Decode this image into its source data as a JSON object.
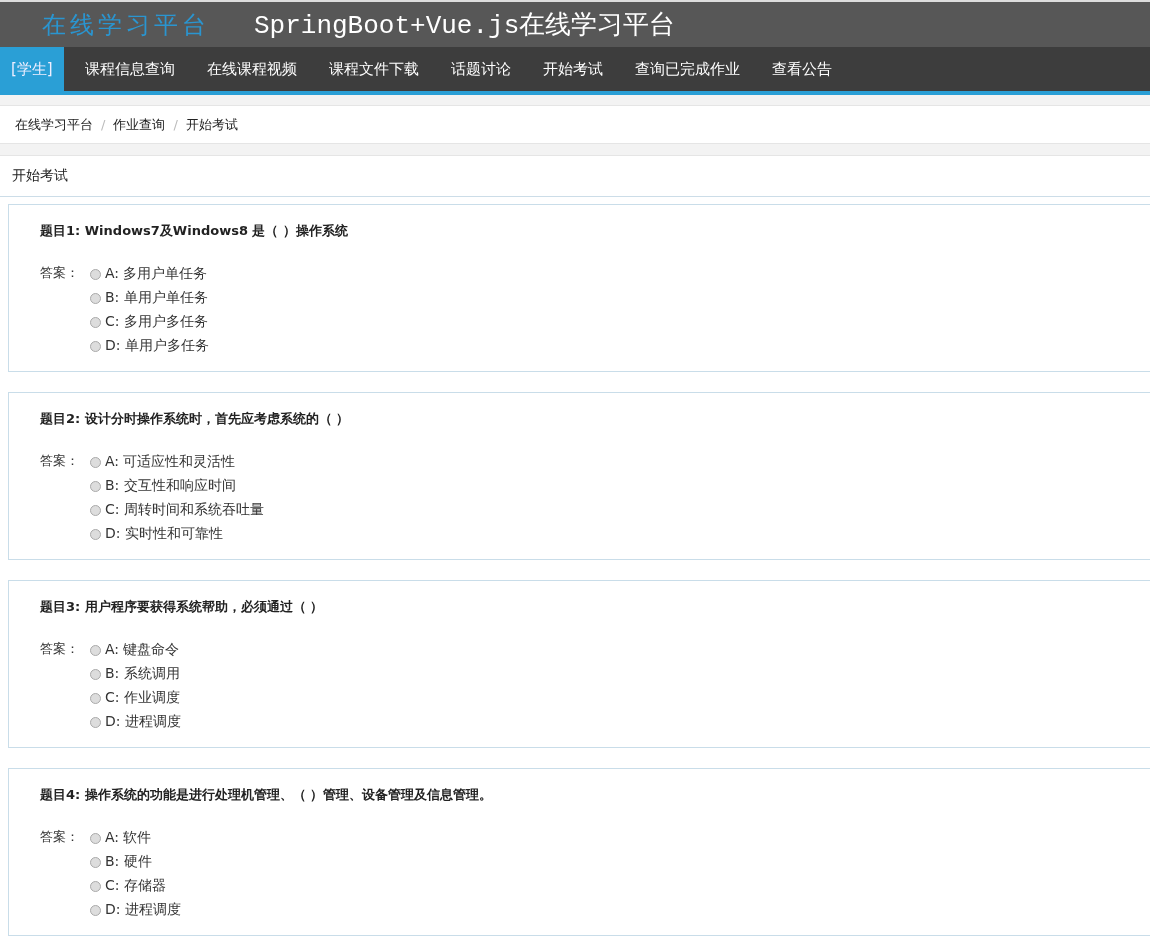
{
  "header": {
    "logo": "在线学习平台",
    "title": "SpringBoot+Vue.js在线学习平台"
  },
  "nav": [
    {
      "label": "[学生]",
      "selected": true
    },
    {
      "label": "课程信息查询",
      "selected": false
    },
    {
      "label": "在线课程视频",
      "selected": false
    },
    {
      "label": "课程文件下载",
      "selected": false
    },
    {
      "label": "话题讨论",
      "selected": false
    },
    {
      "label": "开始考试",
      "selected": false
    },
    {
      "label": "查询已完成作业",
      "selected": false
    },
    {
      "label": "查看公告",
      "selected": false
    }
  ],
  "breadcrumb": [
    {
      "kind": "link",
      "text": "在线学习平台"
    },
    {
      "kind": "separator",
      "text": "/"
    },
    {
      "kind": "link",
      "text": "作业查询"
    },
    {
      "kind": "separator",
      "text": "/"
    },
    {
      "kind": "link",
      "text": "开始考试"
    }
  ],
  "panel_title": "开始考试",
  "questions": [
    {
      "title": "题目1: Windows7及Windows8 是（ ）操作系统",
      "answer_label": "答案：",
      "options": [
        {
          "label": "A: 多用户单任务",
          "selected": false
        },
        {
          "label": "B: 单用户单任务",
          "selected": false
        },
        {
          "label": "C: 多用户多任务",
          "selected": false
        },
        {
          "label": "D: 单用户多任务",
          "selected": false
        }
      ]
    },
    {
      "title": "题目2: 设计分时操作系统时，首先应考虑系统的（ ）",
      "answer_label": "答案：",
      "options": [
        {
          "label": "A: 可适应性和灵活性",
          "selected": false
        },
        {
          "label": "B: 交互性和响应时间",
          "selected": false
        },
        {
          "label": "C: 周转时间和系统吞吐量",
          "selected": false
        },
        {
          "label": "D: 实时性和可靠性",
          "selected": false
        }
      ]
    },
    {
      "title": "题目3: 用户程序要获得系统帮助，必须通过（ ）",
      "answer_label": "答案：",
      "options": [
        {
          "label": "A: 键盘命令",
          "selected": false
        },
        {
          "label": "B: 系统调用",
          "selected": false
        },
        {
          "label": "C: 作业调度",
          "selected": false
        },
        {
          "label": "D: 进程调度",
          "selected": false
        }
      ]
    },
    {
      "title": "题目4: 操作系统的功能是进行处理机管理、（ ）管理、设备管理及信息管理。",
      "answer_label": "答案：",
      "options": [
        {
          "label": "A: 软件",
          "selected": false
        },
        {
          "label": "B: 硬件",
          "selected": false
        },
        {
          "label": "C: 存储器",
          "selected": false
        },
        {
          "label": "D: 进程调度",
          "selected": false
        }
      ]
    }
  ]
}
